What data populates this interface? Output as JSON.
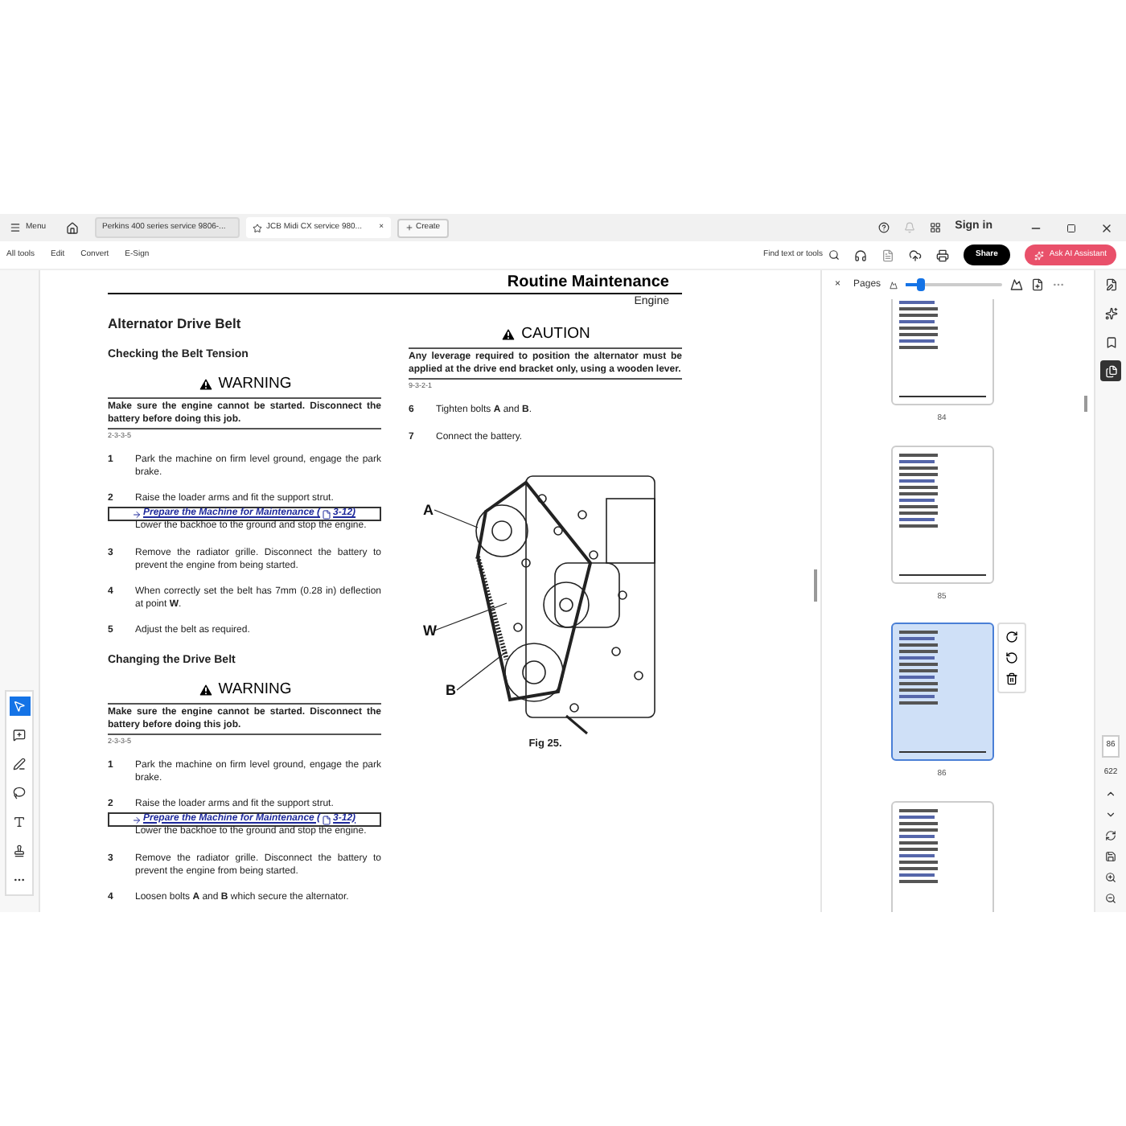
{
  "title_bar": {
    "menu": "Menu",
    "tabs": [
      {
        "label": "Perkins 400 series service 9806-...",
        "selected": false
      },
      {
        "label": "JCB Midi CX service 980...",
        "selected": true,
        "close": "×"
      }
    ],
    "create": "Create",
    "sign_in": "Sign in"
  },
  "toolbar": {
    "items": [
      "All tools",
      "Edit",
      "Convert",
      "E-Sign"
    ],
    "find": "Find text or tools",
    "share": "Share",
    "ai_assistant": "Ask AI Assistant"
  },
  "left_tools": [
    {
      "kind": "select",
      "selected": true
    },
    {
      "kind": "comment",
      "selected": false
    },
    {
      "kind": "draw",
      "selected": false
    },
    {
      "kind": "lasso",
      "selected": false
    },
    {
      "kind": "text",
      "selected": false
    },
    {
      "kind": "stamp",
      "selected": false
    },
    {
      "kind": "more",
      "selected": false
    }
  ],
  "document": {
    "header": "Routine Maintenance",
    "subheader": "Engine",
    "left_column": [
      {
        "kind": "heading",
        "text": "Alternator Drive Belt"
      },
      {
        "kind": "subheading",
        "text": "Checking the Belt Tension"
      },
      {
        "kind": "warning",
        "title": "WARNING",
        "text": "Make sure the engine cannot be started. Disconnect the battery before doing this job.",
        "code": "2-3-3-5"
      },
      {
        "kind": "step",
        "number": "1",
        "text": "Park the machine on firm level ground, engage the park brake."
      },
      {
        "kind": "step",
        "number": "2",
        "text": "Raise the loader arms and fit the support strut.",
        "link": "Prepare the Machine for Maintenance (",
        "link_page": "3-12)",
        "after": "Lower the backhoe to the ground and stop the engine."
      },
      {
        "kind": "step",
        "number": "3",
        "text": "Remove the radiator grille. Disconnect the battery to prevent the engine from being started."
      },
      {
        "kind": "step",
        "number": "4",
        "text": "When correctly set the belt has 7mm (0.28 in) deflection at point **W**."
      },
      {
        "kind": "step",
        "number": "5",
        "text": "Adjust the belt as required."
      },
      {
        "kind": "subheading",
        "text": "Changing the Drive Belt"
      },
      {
        "kind": "warning",
        "title": "WARNING",
        "text": "Make sure the engine cannot be started. Disconnect the battery before doing this job.",
        "code": "2-3-3-5"
      },
      {
        "kind": "step",
        "number": "1",
        "text": "Park the machine on firm level ground, engage the park brake."
      },
      {
        "kind": "step",
        "number": "2",
        "text": "Raise the loader arms and fit the support strut.",
        "link": "Prepare the Machine for Maintenance (",
        "link_page": "3-12)",
        "after": "Lower the backhoe to the ground and stop the engine."
      },
      {
        "kind": "step",
        "number": "3",
        "text": "Remove the radiator grille. Disconnect the battery to prevent the engine from being started."
      },
      {
        "kind": "step",
        "number": "4",
        "text": "Loosen bolts **A** and **B** which secure the alternator."
      }
    ],
    "right_column": [
      {
        "kind": "warning",
        "title": "CAUTION",
        "text": "Any leverage required to position the alternator must be applied at the drive end bracket only, using a wooden lever.",
        "code": "9-3-2-1"
      },
      {
        "kind": "step",
        "number": "6",
        "text": "Tighten bolts **A** and **B**."
      },
      {
        "kind": "step",
        "number": "7",
        "text": "Connect the battery."
      },
      {
        "kind": "figure",
        "labels": [
          "A",
          "W",
          "B"
        ],
        "caption": "Fig 25."
      }
    ]
  },
  "pages_panel": {
    "close": "×",
    "title": "Pages",
    "zoom": {
      "level": 0.15
    },
    "thumbnails": [
      {
        "number": "84",
        "selected": false
      },
      {
        "number": "85",
        "selected": false
      },
      {
        "number": "86",
        "selected": true
      },
      {
        "selected": false
      }
    ]
  },
  "right_rail": {
    "page_number": "86",
    "page_count": "622"
  }
}
